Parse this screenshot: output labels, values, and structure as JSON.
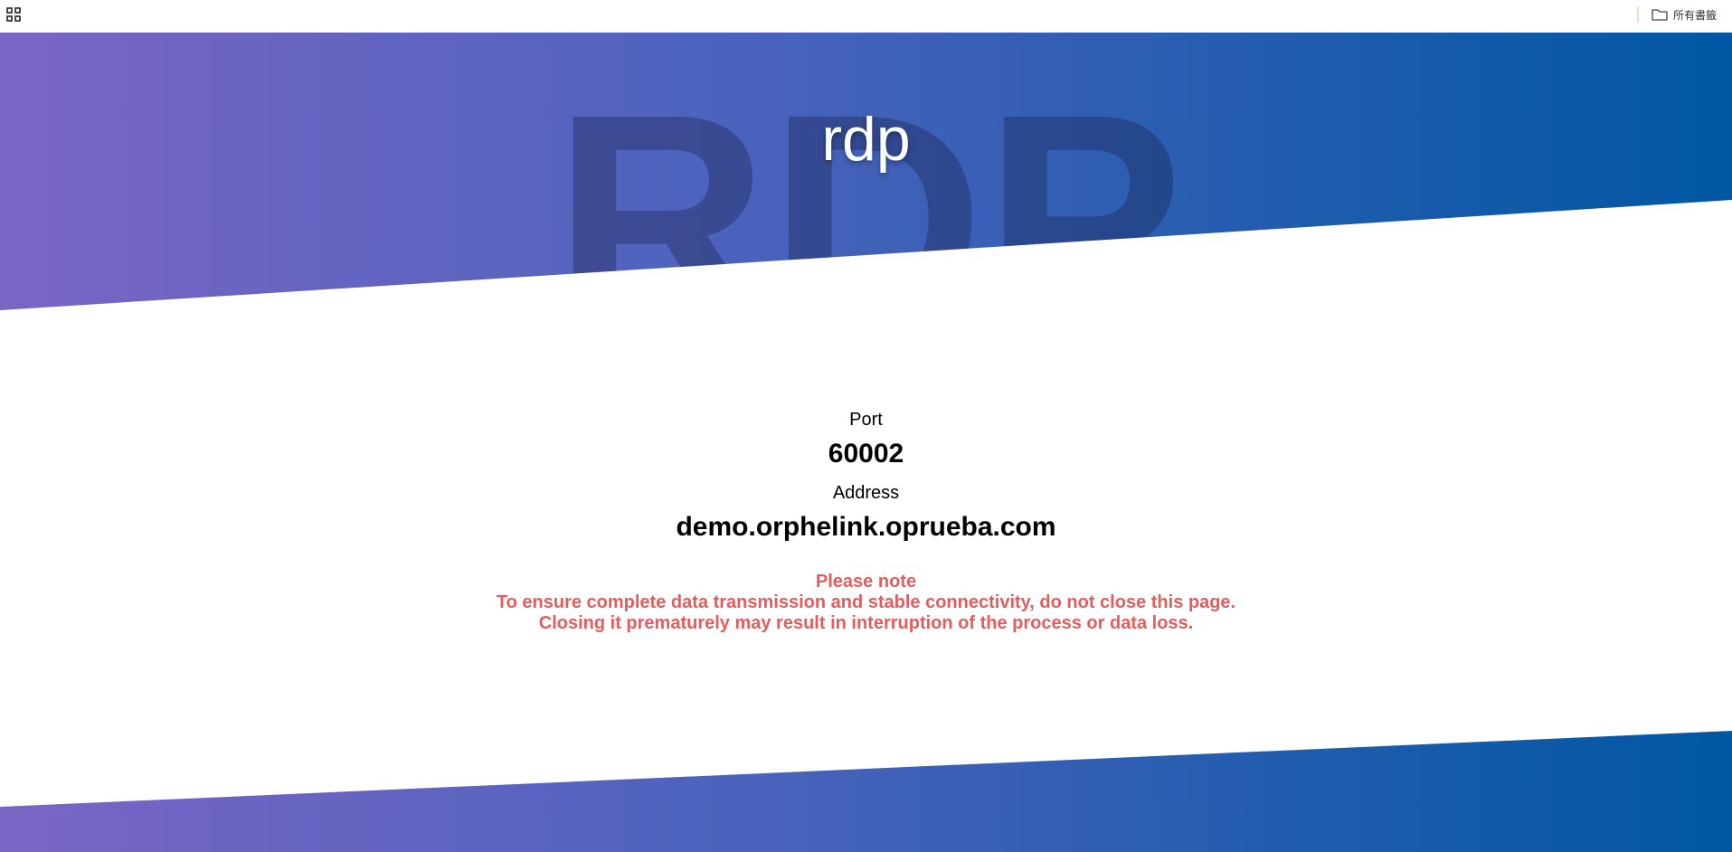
{
  "bookmarks_bar": {
    "apps_icon": "apps-grid-icon",
    "all_bookmarks_label": "所有書籤",
    "all_bookmarks_icon": "folder-icon"
  },
  "hero": {
    "title": "rdp",
    "background_text": "RDP",
    "gradient_start": "#7b65c5",
    "gradient_end": "#0057a3"
  },
  "connection": {
    "port_label": "Port",
    "port_value": "60002",
    "address_label": "Address",
    "address_value": "demo.orphelink.oprueba.com"
  },
  "notice": {
    "heading": "Please note",
    "line1": "To ensure complete data transmission and stable connectivity, do not close this page.",
    "line2": "Closing it prematurely may result in interruption of the process or data loss.",
    "color": "#e35d5d"
  }
}
